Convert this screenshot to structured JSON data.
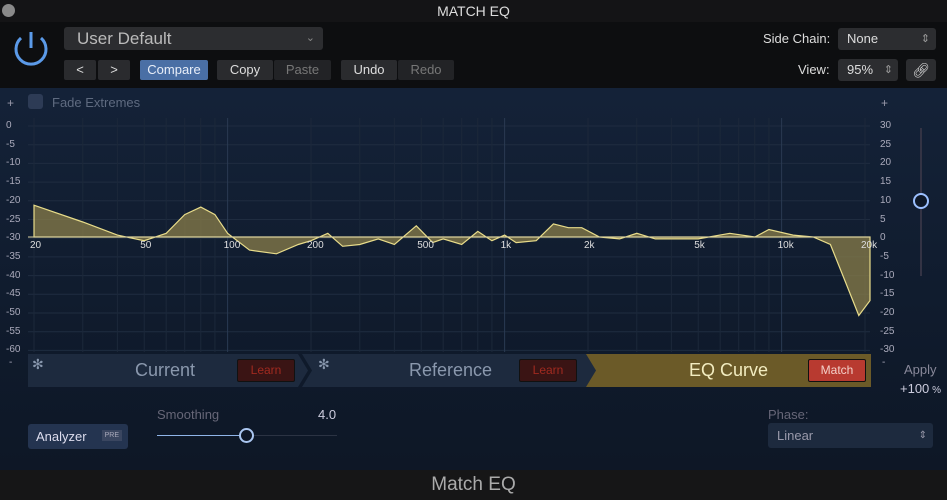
{
  "window": {
    "title": "MATCH EQ",
    "footer": "Match EQ"
  },
  "header": {
    "preset": "User Default",
    "prev": "<",
    "next": ">",
    "compare": "Compare",
    "copy": "Copy",
    "paste": "Paste",
    "undo": "Undo",
    "redo": "Redo",
    "side_chain_label": "Side Chain:",
    "side_chain_value": "None",
    "view_label": "View:",
    "view_value": "95%"
  },
  "graph": {
    "fade_extremes": "Fade Extremes",
    "fade_extremes_checked": false,
    "left_ticks": [
      "0",
      "-5",
      "-10",
      "-15",
      "-20",
      "-25",
      "-30",
      "-35",
      "-40",
      "-45",
      "-50",
      "-55",
      "-60"
    ],
    "right_ticks": [
      "30",
      "25",
      "20",
      "15",
      "10",
      "5",
      "0",
      "-5",
      "-10",
      "-15",
      "-20",
      "-25",
      "-30"
    ],
    "freq_ticks": [
      "20",
      "50",
      "100",
      "200",
      "500",
      "1k",
      "2k",
      "5k",
      "10k",
      "20k"
    ],
    "plus": "+",
    "minus": "-",
    "curve_color": "#e8dc8a",
    "eq_curve": [
      [
        20,
        8.5
      ],
      [
        30,
        4
      ],
      [
        40,
        0.5
      ],
      [
        50,
        -1
      ],
      [
        60,
        1
      ],
      [
        70,
        6
      ],
      [
        80,
        8
      ],
      [
        90,
        6
      ],
      [
        100,
        1
      ],
      [
        120,
        -3.5
      ],
      [
        150,
        -4.5
      ],
      [
        180,
        -2
      ],
      [
        200,
        -1
      ],
      [
        230,
        1
      ],
      [
        260,
        -2.5
      ],
      [
        300,
        -2
      ],
      [
        350,
        -0.5
      ],
      [
        400,
        -2
      ],
      [
        480,
        3
      ],
      [
        550,
        -1.5
      ],
      [
        600,
        -0.5
      ],
      [
        700,
        -2
      ],
      [
        800,
        1.5
      ],
      [
        900,
        -1
      ],
      [
        1000,
        0.5
      ],
      [
        1100,
        -1.5
      ],
      [
        1300,
        -1
      ],
      [
        1500,
        3.5
      ],
      [
        1700,
        2.5
      ],
      [
        1900,
        2.5
      ],
      [
        2200,
        0
      ],
      [
        2600,
        -0.5
      ],
      [
        3000,
        1
      ],
      [
        3500,
        -0.5
      ],
      [
        5000,
        -0.5
      ],
      [
        6500,
        1
      ],
      [
        8000,
        0
      ],
      [
        9000,
        2
      ],
      [
        11000,
        0.5
      ],
      [
        13000,
        0
      ],
      [
        15000,
        -2
      ],
      [
        17000,
        -12
      ],
      [
        19000,
        -21
      ],
      [
        21000,
        -17
      ],
      [
        24000,
        -14
      ]
    ]
  },
  "segments": {
    "current": "Current",
    "reference": "Reference",
    "eq_curve": "EQ Curve",
    "learn": "Learn",
    "match": "Match"
  },
  "apply": {
    "label": "Apply",
    "value": "+100",
    "unit": "%",
    "level_percent": 100
  },
  "bottom": {
    "analyzer": "Analyzer",
    "pre": "PRE",
    "smoothing_label": "Smoothing",
    "smoothing_value": "4.0",
    "smoothing_fraction": 0.5,
    "phase_label": "Phase:",
    "phase_value": "Linear"
  }
}
